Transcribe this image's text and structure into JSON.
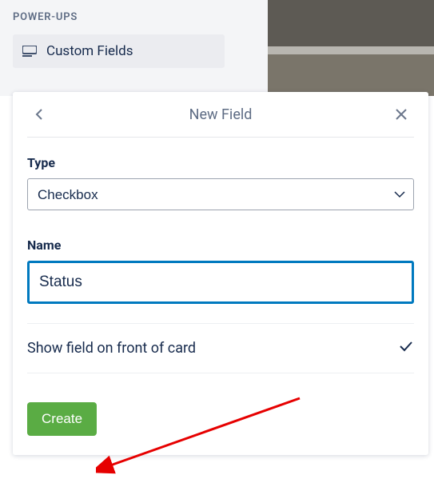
{
  "sidebar": {
    "header": "POWER-UPS",
    "custom_fields_label": "Custom Fields"
  },
  "popover": {
    "title": "New Field",
    "type_label": "Type",
    "type_value": "Checkbox",
    "name_label": "Name",
    "name_value": "Status",
    "show_label": "Show field on front of card",
    "create_label": "Create"
  }
}
